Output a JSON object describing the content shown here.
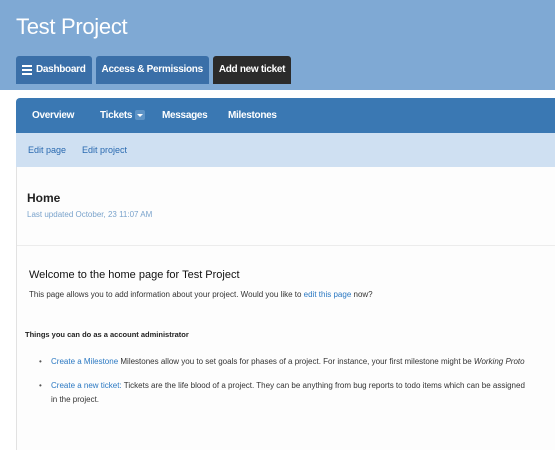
{
  "header": {
    "title": "Test Project",
    "tabs": [
      {
        "label": "Dashboard"
      },
      {
        "label": "Access & Permissions"
      },
      {
        "label": "Add new ticket"
      }
    ]
  },
  "subnav": {
    "items": [
      {
        "label": "Overview"
      },
      {
        "label": "Tickets"
      },
      {
        "label": "Messages"
      },
      {
        "label": "Milestones"
      }
    ]
  },
  "edit_bar": {
    "edit_page": "Edit page",
    "edit_project": "Edit project"
  },
  "page": {
    "title": "Home",
    "updated": "Last updated October, 23 11:07 AM",
    "welcome": "Welcome to the home page for Test Project",
    "intro_before": "This page allows you to add information about your project. Would you like to ",
    "intro_link": "edit this page",
    "intro_after": " now?",
    "things_heading": "Things you can do as a account administrator",
    "items": [
      {
        "link": "Create a Milestone",
        "text": " Milestones allow you to set goals for phases of a project. For instance, your first milestone might be ",
        "em": "Working Proto"
      },
      {
        "link": "Create a new ticket:",
        "text": " Tickets are the life blood of a project. They can be anything from bug reports to todo items which can be assigned",
        "text2": "in the project."
      }
    ]
  },
  "colors": {
    "header_bg": "#7fa9d4",
    "tab_blue": "#3a6fa8",
    "tab_dark": "#2b2b2b",
    "subnav_bg": "#3a78b3",
    "edit_bar_bg": "#cfe0f2",
    "link": "#2a78c2"
  }
}
